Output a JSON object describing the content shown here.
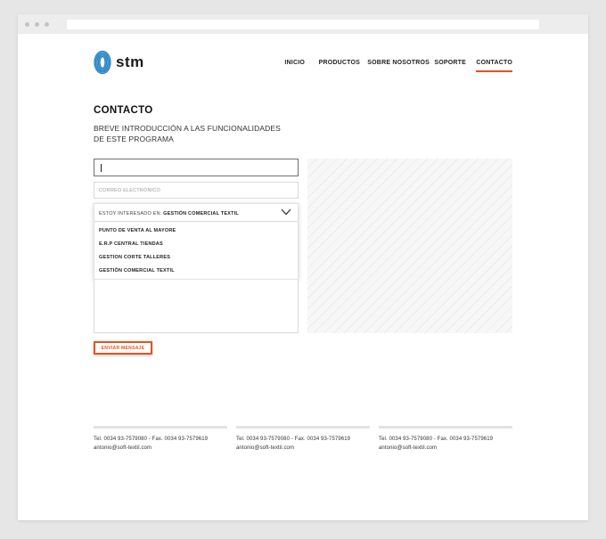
{
  "colors": {
    "accent": "#e8521f",
    "logo_blue": "#1e7fc2"
  },
  "logo": {
    "text": "stm",
    "icon": "stm-coil-logo"
  },
  "nav": {
    "items": [
      {
        "label": "INICIO",
        "active": false
      },
      {
        "label": "PRODUCTOS",
        "active": false
      },
      {
        "label": "SOBRE NOSOTROS",
        "active": false
      },
      {
        "label": "SOPORTE",
        "active": false
      },
      {
        "label": "CONTACTO",
        "active": true
      }
    ]
  },
  "page": {
    "title": "CONTACTO",
    "subtitle_line1": "BREVE INTRODUCCIÓN A LAS FUNCIONALIDADES",
    "subtitle_line2": "DE ESTE PROGRAMA"
  },
  "form": {
    "name_value": "",
    "email_placeholder": "CORREO ELECTRÓNICO",
    "interest": {
      "prefix": "ESTOY INTERESADO EN:",
      "selected": "GESTIÓN COMERCIAL TEXTIL",
      "chevron_icon": "chevron-down-icon",
      "options": [
        "PUNTO DE VENTA AL MAYORE",
        "E.R.P CENTRAL TIENDAS",
        "GESTION CORTE TALLERES",
        "GESTIÓN COMERCIAL TEXTIL"
      ]
    },
    "message_value": "",
    "submit_label": "ENVIAR MENSAJE"
  },
  "footer": {
    "columns": [
      {
        "phone": "Tel. 0034 93-7579080 - Fax. 0034 93-7579619",
        "email": "antonio@soft-textil.com"
      },
      {
        "phone": "Tel. 0034 93-7579080 - Fax. 0034 93-7579619",
        "email": "antonio@soft-textil.com"
      },
      {
        "phone": "Tel. 0034 93-7579080 - Fax. 0034 93-7579619",
        "email": "antonio@soft-textil.com"
      }
    ]
  }
}
